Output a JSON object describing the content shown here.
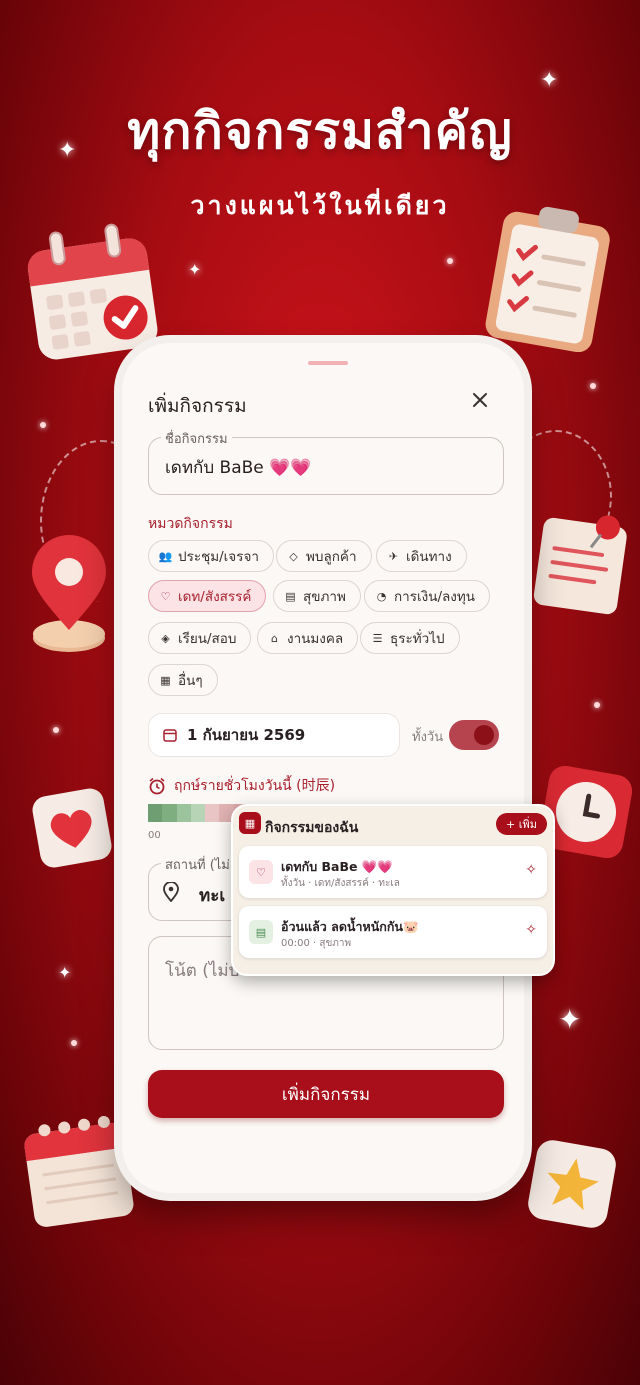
{
  "hero": {
    "title": "ทุกกิจกรรมสำคัญ",
    "subtitle": "วางแผนไว้ในที่เดียว"
  },
  "sheet": {
    "title": "เพิ่มกิจกรรม",
    "close_icon": "close-icon",
    "name_label": "ชื่อกิจกรรม",
    "name_value": "เดทกับ BaBe 💗💗",
    "category_label": "หมวดกิจกรรม",
    "categories": [
      {
        "label": "ประชุม/เจรจา",
        "icon": "people-icon",
        "selected": false
      },
      {
        "label": "พบลูกค้า",
        "icon": "diamond-icon",
        "selected": false
      },
      {
        "label": "เดินทาง",
        "icon": "plane-icon",
        "selected": false
      },
      {
        "label": "เดท/สังสรรค์",
        "icon": "heart-icon",
        "selected": true
      },
      {
        "label": "สุขภาพ",
        "icon": "health-icon",
        "selected": false
      },
      {
        "label": "การเงิน/ลงทุน",
        "icon": "piggy-bank-icon",
        "selected": false
      },
      {
        "label": "เรียน/สอบ",
        "icon": "graduation-cap-icon",
        "selected": false
      },
      {
        "label": "งานมงคล",
        "icon": "temple-icon",
        "selected": false
      },
      {
        "label": "ธุระทั่วไป",
        "icon": "checklist-icon",
        "selected": false
      },
      {
        "label": "อื่นๆ",
        "icon": "calendar-icon",
        "selected": false
      }
    ],
    "date_value": "1 กันยายน 2569",
    "allday_label": "ทั้งวัน",
    "allday_on": true,
    "auspice_label": "ฤกษ์รายชั่วโมงวันนี้ (时辰)",
    "hour_tick": "00",
    "location_label": "สถานที่ (ไม่",
    "location_value": "ทะเ",
    "note_placeholder": "โน้ต (ไม่บั",
    "submit_label": "เพิ่มกิจกรรม"
  },
  "widget": {
    "title": "กิจกรรมของฉัน",
    "add_label": "+ เพิ่ม",
    "items": [
      {
        "title": "เดทกับ BaBe 💗💗",
        "meta": "ทั้งวัน · เดท/สังสรรค์ · ทะเล",
        "icon": "heart-icon"
      },
      {
        "title": "อ้วนแล้ว ลดน้ำหนักกัน🐷",
        "meta": "00:00 · สุขภาพ",
        "icon": "health-icon"
      }
    ]
  },
  "colors": {
    "accent": "#a80f1b",
    "accent_soft": "#fbe3e6",
    "background": "#b00d14"
  }
}
